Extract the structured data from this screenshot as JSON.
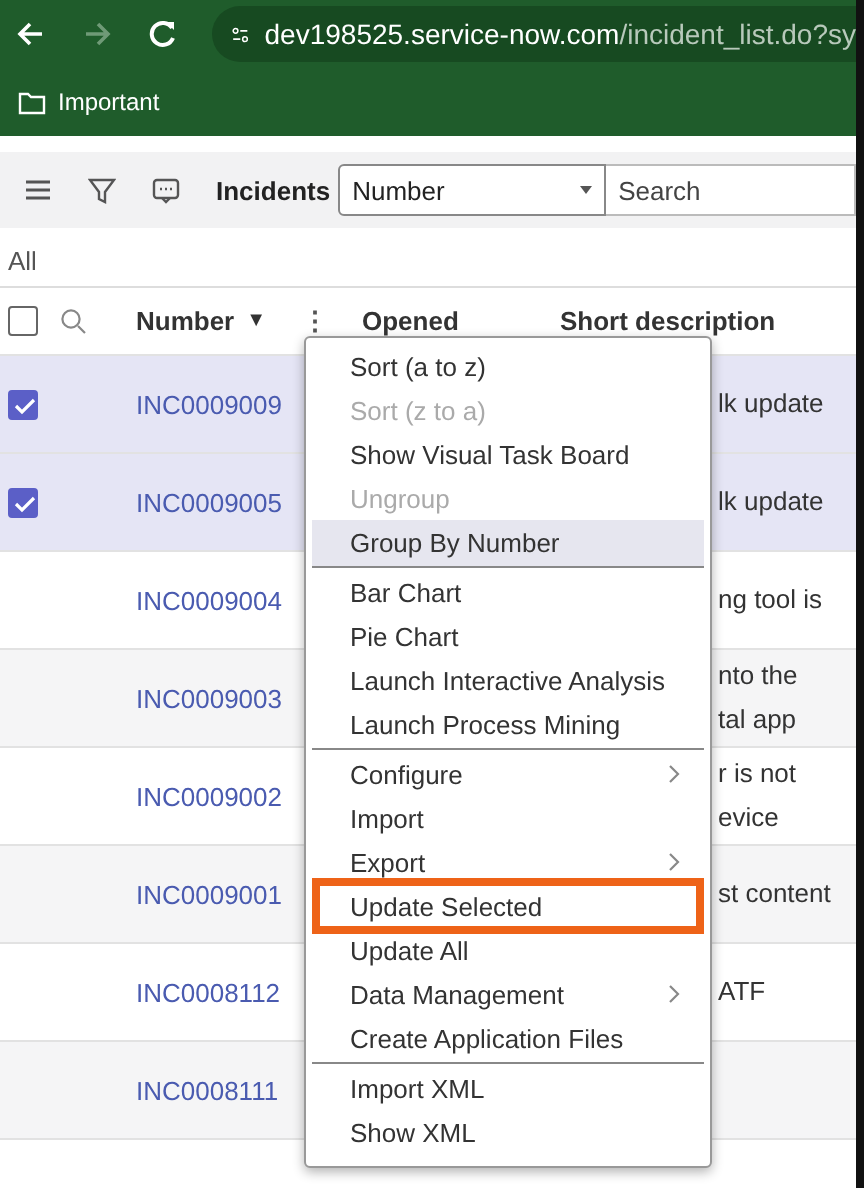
{
  "browser": {
    "url_host": "dev198525.service-now.com",
    "url_path": "/incident_list.do?sy",
    "bookmarks": [
      {
        "label": "Important"
      }
    ]
  },
  "toolbar": {
    "title": "Incidents",
    "field_select": "Number",
    "search_placeholder": "Search"
  },
  "breadcrumb": "All",
  "select_all_checked": false,
  "columns": [
    {
      "label": "Number",
      "sort_indicator": "▼",
      "menu_icon": "⋮"
    },
    {
      "label": "Opened"
    },
    {
      "label": "Short description"
    }
  ],
  "rows": [
    {
      "number": "INC0009009",
      "selected": true,
      "description": [
        "lk update"
      ]
    },
    {
      "number": "INC0009005",
      "selected": true,
      "description": [
        "lk update"
      ]
    },
    {
      "number": "INC0009004",
      "selected": false,
      "description": [
        "ng tool is"
      ]
    },
    {
      "number": "INC0009003",
      "selected": false,
      "description": [
        "nto the",
        "tal app"
      ]
    },
    {
      "number": "INC0009002",
      "selected": false,
      "description": [
        "r is not",
        "evice"
      ]
    },
    {
      "number": "INC0009001",
      "selected": false,
      "description": [
        "st content"
      ]
    },
    {
      "number": "INC0008112",
      "selected": false,
      "description": [
        "ATF"
      ]
    },
    {
      "number": "INC0008111",
      "selected": false,
      "description": []
    }
  ],
  "context_menu": {
    "items": [
      {
        "label": "Sort (a to z)",
        "disabled": false,
        "hovered": false,
        "submenu": false,
        "annotated": false,
        "separator_after": false
      },
      {
        "label": "Sort (z to a)",
        "disabled": true,
        "hovered": false,
        "submenu": false,
        "annotated": false,
        "separator_after": false
      },
      {
        "label": "Show Visual Task Board",
        "disabled": false,
        "hovered": false,
        "submenu": false,
        "annotated": false,
        "separator_after": false
      },
      {
        "label": "Ungroup",
        "disabled": true,
        "hovered": false,
        "submenu": false,
        "annotated": false,
        "separator_after": false
      },
      {
        "label": "Group By Number",
        "disabled": false,
        "hovered": true,
        "submenu": false,
        "annotated": false,
        "separator_after": true
      },
      {
        "label": "Bar Chart",
        "disabled": false,
        "hovered": false,
        "submenu": false,
        "annotated": false,
        "separator_after": false
      },
      {
        "label": "Pie Chart",
        "disabled": false,
        "hovered": false,
        "submenu": false,
        "annotated": false,
        "separator_after": false
      },
      {
        "label": "Launch Interactive Analysis",
        "disabled": false,
        "hovered": false,
        "submenu": false,
        "annotated": false,
        "separator_after": false
      },
      {
        "label": "Launch Process Mining",
        "disabled": false,
        "hovered": false,
        "submenu": false,
        "annotated": false,
        "separator_after": true
      },
      {
        "label": "Configure",
        "disabled": false,
        "hovered": false,
        "submenu": true,
        "annotated": false,
        "separator_after": false
      },
      {
        "label": "Import",
        "disabled": false,
        "hovered": false,
        "submenu": false,
        "annotated": false,
        "separator_after": false
      },
      {
        "label": "Export",
        "disabled": false,
        "hovered": false,
        "submenu": true,
        "annotated": false,
        "separator_after": false
      },
      {
        "label": "Update Selected",
        "disabled": false,
        "hovered": false,
        "submenu": false,
        "annotated": true,
        "separator_after": false
      },
      {
        "label": "Update All",
        "disabled": false,
        "hovered": false,
        "submenu": false,
        "annotated": false,
        "separator_after": false
      },
      {
        "label": "Data Management",
        "disabled": false,
        "hovered": false,
        "submenu": true,
        "annotated": false,
        "separator_after": false
      },
      {
        "label": "Create Application Files",
        "disabled": false,
        "hovered": false,
        "submenu": false,
        "annotated": false,
        "separator_after": true
      },
      {
        "label": "Import XML",
        "disabled": false,
        "hovered": false,
        "submenu": false,
        "annotated": false,
        "separator_after": false
      },
      {
        "label": "Show XML",
        "disabled": false,
        "hovered": false,
        "submenu": false,
        "annotated": false,
        "separator_after": false
      }
    ]
  }
}
